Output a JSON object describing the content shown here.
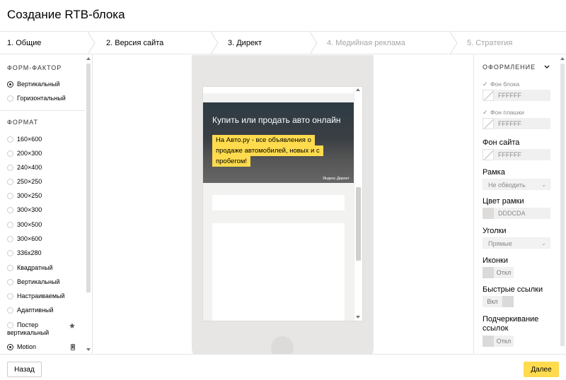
{
  "header": {
    "title": "Создание RTB-блока"
  },
  "steps": [
    {
      "label": "1. Общие",
      "enabled": true
    },
    {
      "label": "2. Версия сайта",
      "enabled": true
    },
    {
      "label": "3. Директ",
      "enabled": true
    },
    {
      "label": "4. Медийная реклама",
      "enabled": false
    },
    {
      "label": "5. Стратегия",
      "enabled": false
    }
  ],
  "left": {
    "form_factor_title": "ФОРМ-ФАКТОР",
    "form_factors": [
      {
        "label": "Вертикальный",
        "checked": true
      },
      {
        "label": "Горизонтальный",
        "checked": false
      }
    ],
    "format_title": "ФОРМАТ",
    "formats": [
      {
        "label": "160×600",
        "checked": false
      },
      {
        "label": "200×300",
        "checked": false
      },
      {
        "label": "240×400",
        "checked": false
      },
      {
        "label": "250×250",
        "checked": false
      },
      {
        "label": "300×250",
        "checked": false
      },
      {
        "label": "300×300",
        "checked": false
      },
      {
        "label": "300×500",
        "checked": false
      },
      {
        "label": "300×600",
        "checked": false
      },
      {
        "label": "336x280",
        "checked": false
      },
      {
        "label": "Квадратный",
        "checked": false
      },
      {
        "label": "Вертикальный",
        "checked": false
      },
      {
        "label": "Настраиваемый",
        "checked": false
      },
      {
        "label": "Адаптивный",
        "checked": false
      },
      {
        "label": "Постер вертикальный",
        "checked": false,
        "icon": "star-icon"
      },
      {
        "label": "Motion",
        "checked": true,
        "icon": "mobile-icon"
      }
    ]
  },
  "preview": {
    "ad_title": "Купить или продать авто онлайн",
    "ad_text": "На Авто.ру - все объявления о продаже автомобилей, новых и с пробегом!",
    "ad_brand": "Яндекс.Директ"
  },
  "right": {
    "section_title": "ОФОРМЛЕНИЕ",
    "block_bg_label": "Фон блока",
    "block_bg_value": "FFFFFF",
    "plate_bg_label": "Фон плашки",
    "plate_bg_value": "FFFFFF",
    "site_bg_label": "Фон сайта",
    "site_bg_value": "FFFFFF",
    "frame_label": "Рамка",
    "frame_value": "Не обводить",
    "frame_color_label": "Цвет рамки",
    "frame_color_value": "DDDCDA",
    "corners_label": "Уголки",
    "corners_value": "Прямые",
    "icons_label": "Иконки",
    "icons_value": "Откл",
    "quick_links_label": "Быстрые ссылки",
    "quick_links_value": "Вкл",
    "underline_label": "Подчеркивание ссылок",
    "underline_value": "Откл"
  },
  "footer": {
    "back_label": "Назад",
    "next_label": "Далее"
  },
  "colors": {
    "accent": "#ffdb4d",
    "border": "#e5e5e5",
    "phone": "#e7e6e4"
  }
}
